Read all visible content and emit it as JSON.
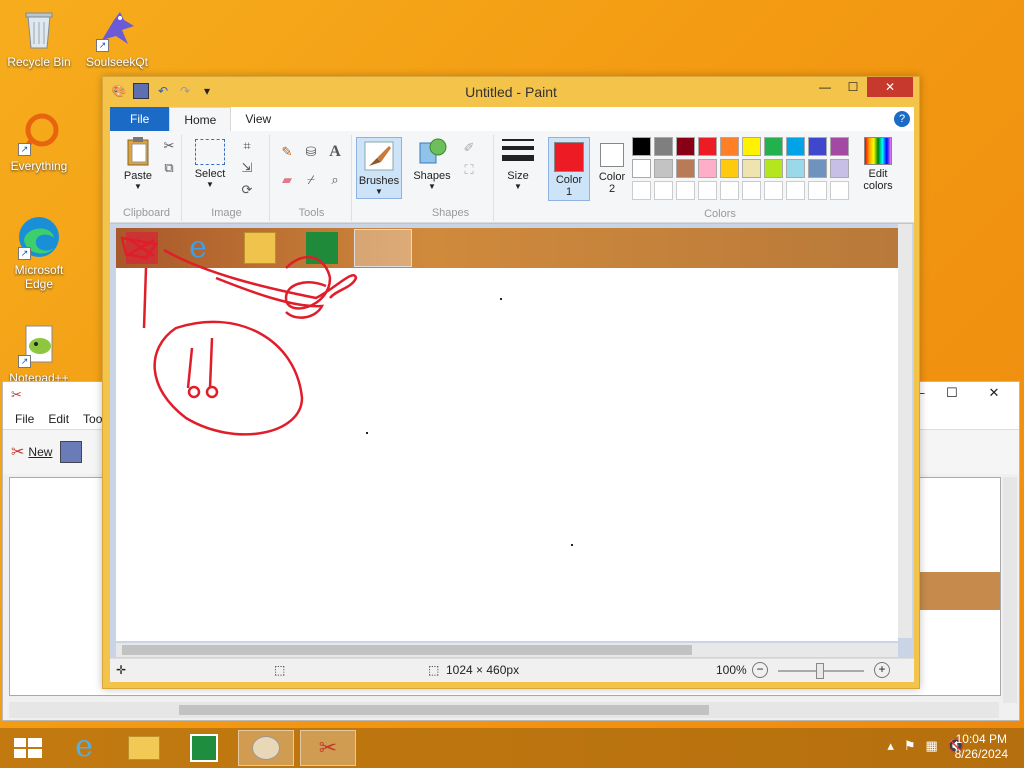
{
  "desktop": {
    "icons": [
      {
        "label": "Recycle Bin"
      },
      {
        "label": "SoulseekQt"
      },
      {
        "label": "Everything"
      },
      {
        "label": "Microsoft Edge"
      },
      {
        "label": "Notepad++"
      }
    ]
  },
  "back_window": {
    "menu": [
      "File",
      "Edit",
      "Too"
    ],
    "toolbar_new": "New"
  },
  "paint": {
    "title": "Untitled - Paint",
    "tabs": {
      "file": "File",
      "home": "Home",
      "view": "View"
    },
    "help": "?",
    "groups": {
      "clipboard": "Clipboard",
      "image": "Image",
      "tools": "Tools",
      "shapes": "Shapes",
      "colors": "Colors"
    },
    "buttons": {
      "paste": "Paste",
      "select": "Select",
      "brushes": "Brushes",
      "shapes": "Shapes",
      "size": "Size",
      "color1_line1": "Color",
      "color1_line2": "1",
      "color2_line1": "Color",
      "color2_line2": "2",
      "edit_colors_line1": "Edit",
      "edit_colors_line2": "colors"
    },
    "text_tool": "A",
    "palette_row1": [
      "#000000",
      "#7f7f7f",
      "#880015",
      "#ed1c24",
      "#ff7f27",
      "#fff200",
      "#22b14c",
      "#00a2e8",
      "#3f48cc",
      "#a349a4"
    ],
    "palette_row2": [
      "#ffffff",
      "#c3c3c3",
      "#b97a57",
      "#ffaec9",
      "#ffc90e",
      "#efe4b0",
      "#b5e61d",
      "#99d9ea",
      "#7092be",
      "#c8bfe7"
    ],
    "color1": "#ed1c24",
    "color2": "#ffffff",
    "status": {
      "dimensions": "1024 × 460px",
      "zoom": "100%"
    }
  },
  "taskbar": {
    "clock_time": "10:04 PM",
    "clock_date": "8/26/2024"
  }
}
